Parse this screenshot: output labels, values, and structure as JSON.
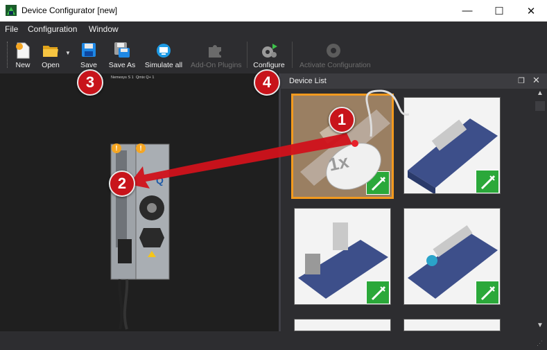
{
  "window": {
    "title": "Device Configurator [new]",
    "controls": {
      "minimize": "—",
      "maximize": "☐",
      "close": "✕"
    }
  },
  "menu": [
    "File",
    "Configuration",
    "Window"
  ],
  "toolbar": {
    "new_label": "New",
    "open_label": "Open",
    "save_label": "Save",
    "save_as_label": "Save As",
    "simulate_label": "Simulate all",
    "addon_label": "Add-On Plugins",
    "configure_label": "Configure",
    "activate_label": "Activate Configuration"
  },
  "canvas": {
    "device_labels": [
      "Nemesys S 1",
      "Qmix Q+ 1"
    ]
  },
  "device_list": {
    "title": "Device List",
    "mouse_hint": "1x",
    "items": [
      {
        "name": "syringe-pump-1",
        "selected": true
      },
      {
        "name": "syringe-pump-2",
        "selected": false
      },
      {
        "name": "syringe-pump-3",
        "selected": false
      },
      {
        "name": "syringe-pump-4",
        "selected": false
      },
      {
        "name": "syringe-pump-5",
        "selected": false
      },
      {
        "name": "syringe-pump-6",
        "selected": false
      }
    ]
  },
  "callouts": [
    "1",
    "2",
    "3",
    "4"
  ],
  "colors": {
    "accent": "#f39a1e",
    "callout": "#c8141b",
    "badge": "#2ba83a",
    "dark_bg": "#2d2d30"
  }
}
